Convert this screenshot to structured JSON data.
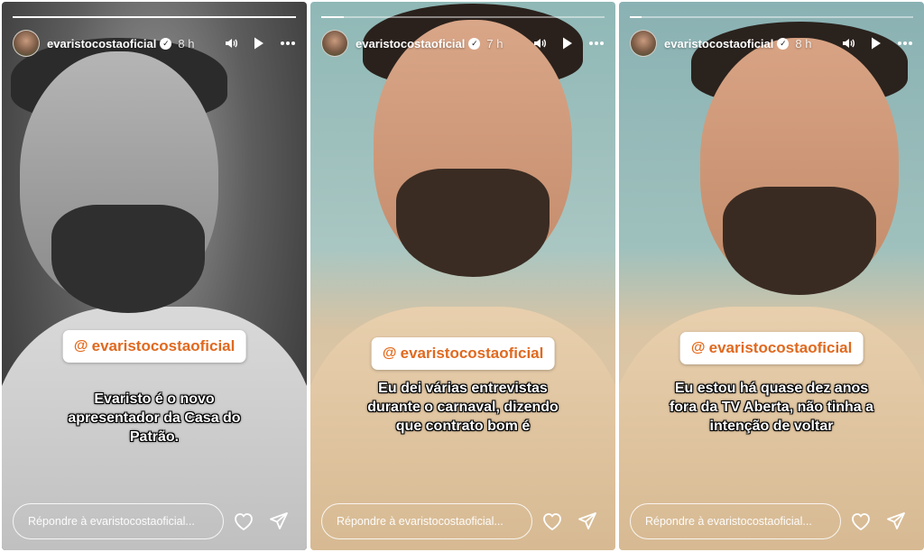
{
  "stories": [
    {
      "progress": 1.0,
      "username": "evaristocostaoficial",
      "verified_mark": "✓",
      "time": "8 h",
      "mention": "evaristocostaoficial",
      "caption": "Evaristo é o novo apresentador da Casa do Patrão.",
      "reply_placeholder": "Répondre à evaristocostaoficial..."
    },
    {
      "progress": 0.08,
      "username": "evaristocostaoficial",
      "verified_mark": "✓",
      "time": "7 h",
      "mention": "evaristocostaoficial",
      "caption": "Eu dei várias entrevistas durante o carnaval, dizendo que contrato bom é",
      "reply_placeholder": "Répondre à evaristocostaoficial..."
    },
    {
      "progress": 0.04,
      "username": "evaristocostaoficial",
      "verified_mark": "✓",
      "time": "8 h",
      "mention": "evaristocostaoficial",
      "caption": "Eu estou há quase dez anos fora da TV Aberta, não tinha a intenção de voltar",
      "reply_placeholder": "Répondre à evaristocostaoficial..."
    }
  ],
  "icons": {
    "sound": "speaker-icon",
    "play": "play-icon",
    "more": "more-icon",
    "mention": "mention-at-icon",
    "like": "heart-icon",
    "share": "send-icon"
  },
  "colors": {
    "mention_text": "#e0691f",
    "caption_text": "#ffffff"
  }
}
